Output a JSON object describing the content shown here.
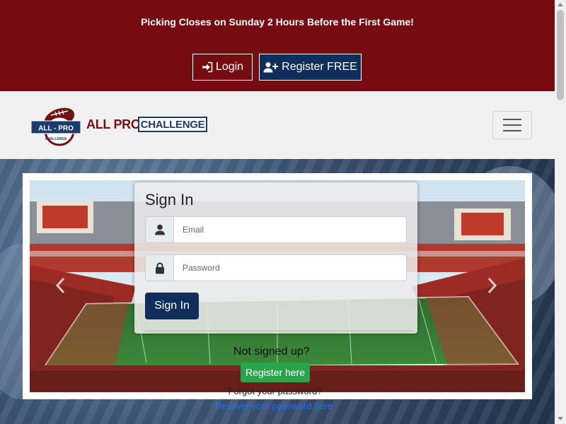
{
  "top_banner": {
    "notice": "Picking Closes on Sunday 2 Hours Before the First Game!",
    "login_label": "Login",
    "register_label": "Register FREE"
  },
  "brand": {
    "logo_top": "ALL - PRO",
    "logo_bottom": "CHALLENGE",
    "name_part1": "ALL PRO",
    "name_part2": "CHALLENGE"
  },
  "signin": {
    "title": "Sign In",
    "email_placeholder": "Email",
    "password_placeholder": "Password",
    "button_label": "Sign In"
  },
  "register_prompt": {
    "text": "Not signed up?",
    "button_label": "Register here"
  },
  "recovery": {
    "prompt": "Forgot your password?",
    "link": "Recover your password here"
  },
  "icons": {
    "login": "sign-in-icon",
    "register": "user-plus-icon",
    "email": "user-icon",
    "password": "lock-icon",
    "menu": "hamburger-icon",
    "prev": "chevron-left-icon",
    "next": "chevron-right-icon"
  },
  "colors": {
    "banner": "#770b12",
    "primary": "#0f2e5c",
    "success": "#2aa44a",
    "link": "#1a73e8"
  }
}
